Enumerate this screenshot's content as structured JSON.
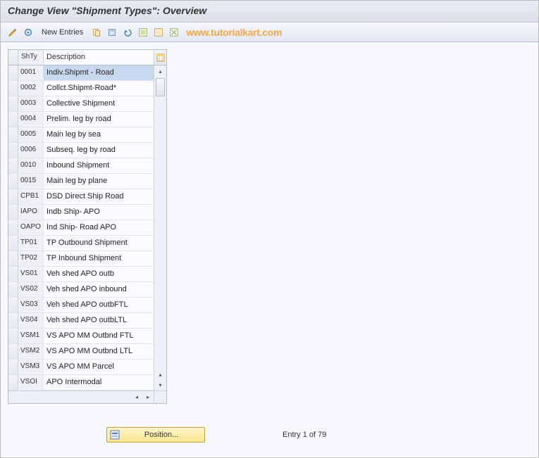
{
  "title": "Change View \"Shipment Types\": Overview",
  "toolbar": {
    "new_entries_label": "New Entries"
  },
  "watermark": "www.tutorialkart.com",
  "grid": {
    "headers": {
      "shty": "ShTy",
      "desc": "Description"
    },
    "rows": [
      {
        "shty": "0001",
        "desc": "Indiv.Shipmt - Road",
        "selected": true
      },
      {
        "shty": "0002",
        "desc": "Collct.Shipmt-Road*"
      },
      {
        "shty": "0003",
        "desc": "Collective Shipment"
      },
      {
        "shty": "0004",
        "desc": "Prelim. leg by road"
      },
      {
        "shty": "0005",
        "desc": "Main leg by sea"
      },
      {
        "shty": "0006",
        "desc": "Subseq. leg by road"
      },
      {
        "shty": "0010",
        "desc": "Inbound Shipment"
      },
      {
        "shty": "0015",
        "desc": "Main leg by plane"
      },
      {
        "shty": "CPB1",
        "desc": "DSD Direct Ship Road"
      },
      {
        "shty": "IAPO",
        "desc": "Indb Ship- APO"
      },
      {
        "shty": "OAPO",
        "desc": "Ind Ship- Road APO"
      },
      {
        "shty": "TP01",
        "desc": "TP Outbound Shipment"
      },
      {
        "shty": "TP02",
        "desc": "TP Inbound Shipment"
      },
      {
        "shty": "VS01",
        "desc": "Veh shed APO outb"
      },
      {
        "shty": "VS02",
        "desc": "Veh shed APO inbound"
      },
      {
        "shty": "VS03",
        "desc": "Veh shed APO outbFTL"
      },
      {
        "shty": "VS04",
        "desc": "Veh shed APO outbLTL"
      },
      {
        "shty": "VSM1",
        "desc": "VS APO MM Outbnd FTL"
      },
      {
        "shty": "VSM2",
        "desc": "VS APO MM Outbnd LTL"
      },
      {
        "shty": "VSM3",
        "desc": "VS APO MM Parcel"
      },
      {
        "shty": "VSOI",
        "desc": "APO Intermodal"
      }
    ]
  },
  "footer": {
    "position_label": "Position...",
    "entry_text": "Entry 1 of 79"
  }
}
